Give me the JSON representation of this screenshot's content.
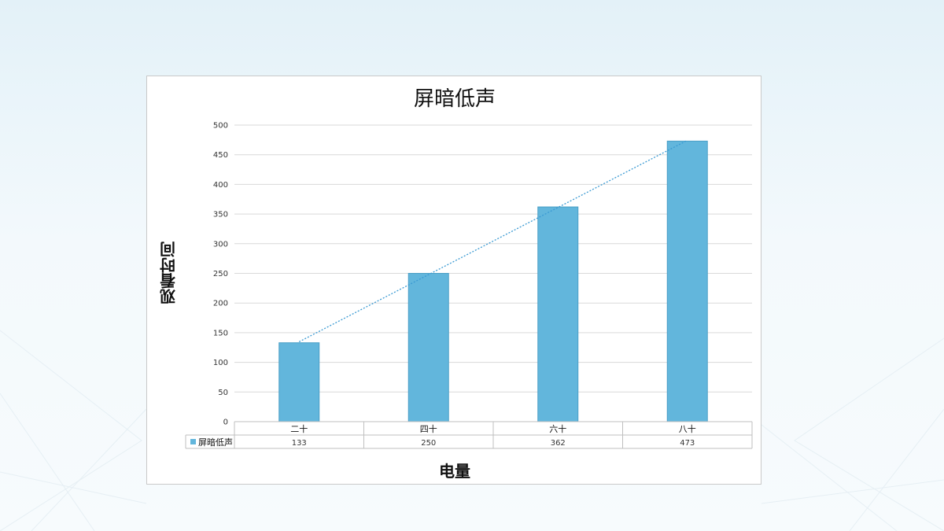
{
  "chart_data": {
    "type": "bar",
    "title": "屏暗低声",
    "xlabel": "电量",
    "ylabel": "观看时间",
    "categories": [
      "二十",
      "四十",
      "六十",
      "八十"
    ],
    "series": [
      {
        "name": "屏暗低声",
        "values": [
          133,
          250,
          362,
          473
        ]
      }
    ],
    "ylim": [
      0,
      500
    ],
    "yticks": [
      0,
      50,
      100,
      150,
      200,
      250,
      300,
      350,
      400,
      450,
      500
    ],
    "grid": true,
    "trendline": "linear",
    "data_table": true,
    "colors": {
      "bar": "#62b6dc",
      "bar_border": "#4a9fc6",
      "trend": "#3a9ad3",
      "grid": "#d9d9d9"
    }
  }
}
